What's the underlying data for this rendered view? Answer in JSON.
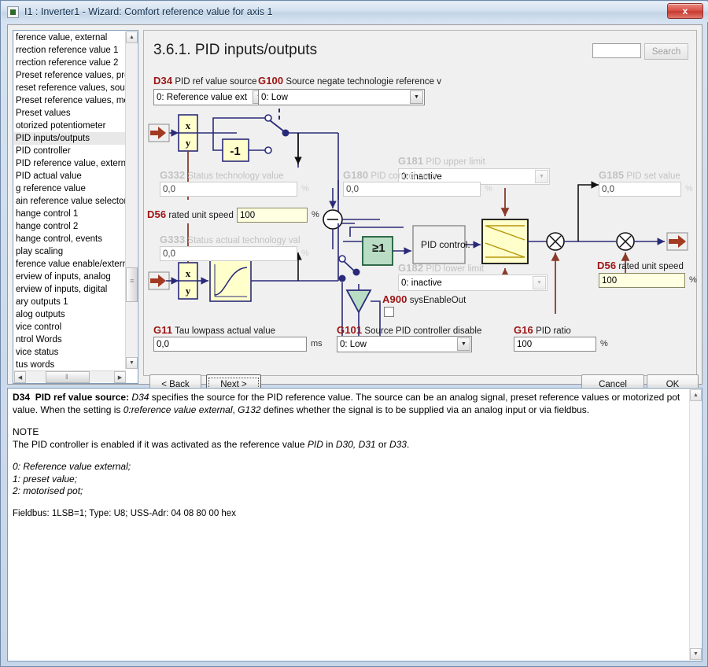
{
  "window": {
    "title": "I1 : Inverter1 - Wizard: Comfort reference value for axis 1",
    "close_label": "x"
  },
  "tree": {
    "items": [
      {
        "label": "ference value, external",
        "selected": false
      },
      {
        "label": "rrection reference value 1",
        "selected": false
      },
      {
        "label": "rrection reference value 2",
        "selected": false
      },
      {
        "label": "Preset reference values, prese",
        "selected": false
      },
      {
        "label": "reset reference values, sourc",
        "selected": false
      },
      {
        "label": "Preset reference values, monit",
        "selected": false
      },
      {
        "label": "Preset values",
        "selected": false
      },
      {
        "label": "otorized potentiometer",
        "selected": false
      },
      {
        "label": "PID inputs/outputs",
        "selected": true
      },
      {
        "label": "PID controller",
        "selected": false
      },
      {
        "label": "PID reference value, external",
        "selected": false
      },
      {
        "label": "PID actual value",
        "selected": false
      },
      {
        "label": "g reference value",
        "selected": false
      },
      {
        "label": "ain reference value selector",
        "selected": false
      },
      {
        "label": "hange control 1",
        "selected": false
      },
      {
        "label": "hange control 2",
        "selected": false
      },
      {
        "label": "hange control, events",
        "selected": false
      },
      {
        "label": "play scaling",
        "selected": false
      },
      {
        "label": "ference value enable/externa",
        "selected": false
      },
      {
        "label": "erview of inputs, analog",
        "selected": false
      },
      {
        "label": "erview of inputs, digital",
        "selected": false
      },
      {
        "label": "ary outputs 1",
        "selected": false
      },
      {
        "label": "alog outputs",
        "selected": false
      },
      {
        "label": "vice control",
        "selected": false
      },
      {
        "label": "ntrol Words",
        "selected": false
      },
      {
        "label": "vice status",
        "selected": false
      },
      {
        "label": "tus words",
        "selected": false
      }
    ]
  },
  "content": {
    "page_title": "3.6.1. PID inputs/outputs",
    "search": {
      "value": "",
      "placeholder": "",
      "button_label": "Search"
    }
  },
  "parameters": {
    "d34": {
      "code": "D34",
      "label": "PID ref value source",
      "value": "0: Reference value ext"
    },
    "g100": {
      "code": "G100",
      "label": "Source negate technologie reference v",
      "value": "0: Low"
    },
    "g332": {
      "code": "G332",
      "label": "Status technology value",
      "value": "0,0",
      "unit": "%"
    },
    "g333": {
      "code": "G333",
      "label": "Status actual technology val",
      "value": "0,0",
      "unit": "%"
    },
    "d56_left": {
      "code": "D56",
      "label": "rated unit speed",
      "value": "100",
      "unit": "%"
    },
    "d56_right": {
      "code": "D56",
      "label": "rated unit speed",
      "value": "100",
      "unit": "%"
    },
    "g180": {
      "code": "G180",
      "label": "PID control error",
      "value": "0,0",
      "unit": "%"
    },
    "g181": {
      "code": "G181",
      "label": "PID upper limit",
      "value": "0: inactive"
    },
    "g182": {
      "code": "G182",
      "label": "PID lower limit",
      "value": "0: inactive"
    },
    "g185": {
      "code": "G185",
      "label": "PID set value",
      "value": "0,0",
      "unit": "%"
    },
    "a900": {
      "code": "A900",
      "label": "sysEnableOut",
      "checked": false
    },
    "g11": {
      "code": "G11",
      "label": "Tau lowpass actual value",
      "value": "0,0",
      "unit": "ms"
    },
    "g101": {
      "code": "G101",
      "label": "Source PID controller disable",
      "value": "0: Low"
    },
    "g16": {
      "code": "G16",
      "label": "PID ratio",
      "value": "100",
      "unit": "%"
    }
  },
  "diagram": {
    "block_xy_top": {
      "numerator": "x",
      "denominator": "y"
    },
    "block_xy_bottom": {
      "numerator": "x",
      "denominator": "y"
    },
    "block_negate": "-1",
    "block_or": "≥1",
    "block_pid": "PID control."
  },
  "buttons": {
    "back": "< Back",
    "next": "Next >",
    "cancel": "Cancel",
    "ok": "OK"
  },
  "help": {
    "line1_code": "D34",
    "line1_title": "PID ref value source:",
    "line1_a": "D34",
    "line1_b": " specifies the source for the PID reference value. The source can be an analog signal, preset reference values or motorized pot value. When the setting is ",
    "line1_c": "0:reference value external",
    "line1_d": ", ",
    "line1_e": "G132",
    "line1_f": " defines whether the signal is to be supplied via an analog input or via fieldbus.",
    "note_heading": "NOTE",
    "note_a": "The PID controller is enabled if it was activated as the reference value ",
    "note_b": "PID",
    "note_c": " in ",
    "note_d": "D30, D31",
    "note_e": " or ",
    "note_f": "D33",
    "note_g": ".",
    "opt0": "0:  Reference value external;",
    "opt1": "1:  preset value;",
    "opt2": "2:  motorised pot;",
    "fieldbus": "Fieldbus: 1LSB=1; Type: U8; USS-Adr: 04 08 80 00 hex"
  },
  "colors": {
    "param_code": "#9c1414",
    "param_code_dim": "#c2c2c2",
    "wire": "#2a2a7a",
    "wire_red": "#8b3a2a",
    "block_fill": "#ffffcc",
    "logic_fill": "#b9ddc4",
    "titlebar": "#d3e0ee"
  }
}
